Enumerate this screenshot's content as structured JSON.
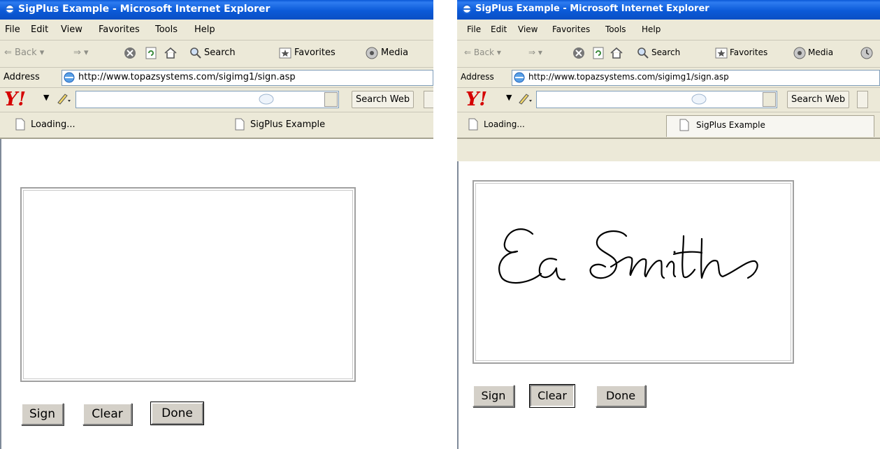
{
  "windows": [
    {
      "title": "SigPlus Example - Microsoft Internet Explorer",
      "menu": [
        "File",
        "Edit",
        "View",
        "Favorites",
        "Tools",
        "Help"
      ],
      "toolbar": {
        "back": "Back",
        "search": "Search",
        "favorites": "Favorites",
        "media": "Media"
      },
      "address": {
        "label": "Address",
        "url": "http://www.topazsystems.com/sigimg1/sign.asp"
      },
      "yahoo": {
        "logo": "Y!",
        "search_web": "Search Web"
      },
      "tabs": [
        {
          "label": "Loading..."
        },
        {
          "label": "SigPlus Example"
        }
      ],
      "signature_present": false,
      "buttons": {
        "sign": "Sign",
        "clear": "Clear",
        "done": "Done"
      }
    },
    {
      "title": "SigPlus Example - Microsoft Internet Explorer",
      "menu": [
        "File",
        "Edit",
        "View",
        "Favorites",
        "Tools",
        "Help"
      ],
      "toolbar": {
        "back": "Back",
        "search": "Search",
        "favorites": "Favorites",
        "media": "Media"
      },
      "address": {
        "label": "Address",
        "url": "http://www.topazsystems.com/sigimg1/sign.asp"
      },
      "yahoo": {
        "logo": "Y!",
        "search_web": "Search Web"
      },
      "tabs": [
        {
          "label": "Loading..."
        },
        {
          "label": "SigPlus Example"
        }
      ],
      "signature_present": true,
      "buttons": {
        "sign": "Sign",
        "clear": "Clear",
        "done": "Done"
      }
    }
  ]
}
